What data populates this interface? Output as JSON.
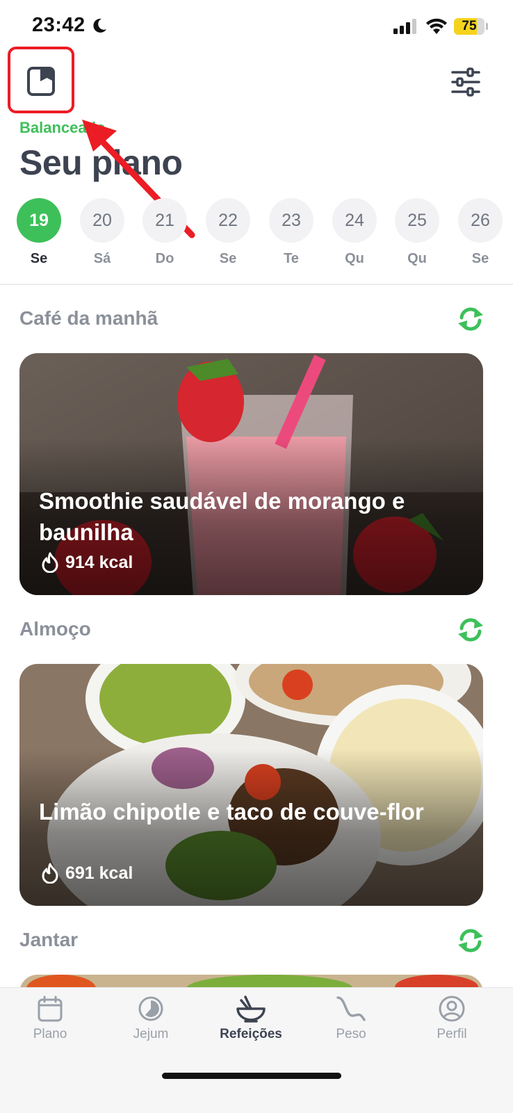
{
  "status_bar": {
    "time": "23:42",
    "battery": "75",
    "battery_level": 0.75
  },
  "header": {
    "subtitle": "Balanceado",
    "title": "Seu plano"
  },
  "dates": [
    {
      "num": "19",
      "day": "Se",
      "active": true
    },
    {
      "num": "20",
      "day": "Sá"
    },
    {
      "num": "21",
      "day": "Do"
    },
    {
      "num": "22",
      "day": "Se"
    },
    {
      "num": "23",
      "day": "Te"
    },
    {
      "num": "24",
      "day": "Qu"
    },
    {
      "num": "25",
      "day": "Qu"
    },
    {
      "num": "26",
      "day": "Se"
    }
  ],
  "meals": [
    {
      "section": "Café da manhã",
      "title": "Smoothie saudável de morango e baunilha",
      "kcal": "914 kcal"
    },
    {
      "section": "Almoço",
      "title": "Limão chipotle e taco de couve-flor",
      "kcal": "691 kcal"
    },
    {
      "section": "Jantar"
    }
  ],
  "nav": [
    {
      "label": "Plano",
      "icon": "calendar-icon"
    },
    {
      "label": "Jejum",
      "icon": "fasting-clock-icon"
    },
    {
      "label": "Refeições",
      "icon": "bowl-icon",
      "active": true
    },
    {
      "label": "Peso",
      "icon": "weight-curve-icon"
    },
    {
      "label": "Perfil",
      "icon": "profile-icon"
    }
  ],
  "colors": {
    "accent": "#3dc05a",
    "annotation": "#ec1c24",
    "title": "#3d4350"
  }
}
